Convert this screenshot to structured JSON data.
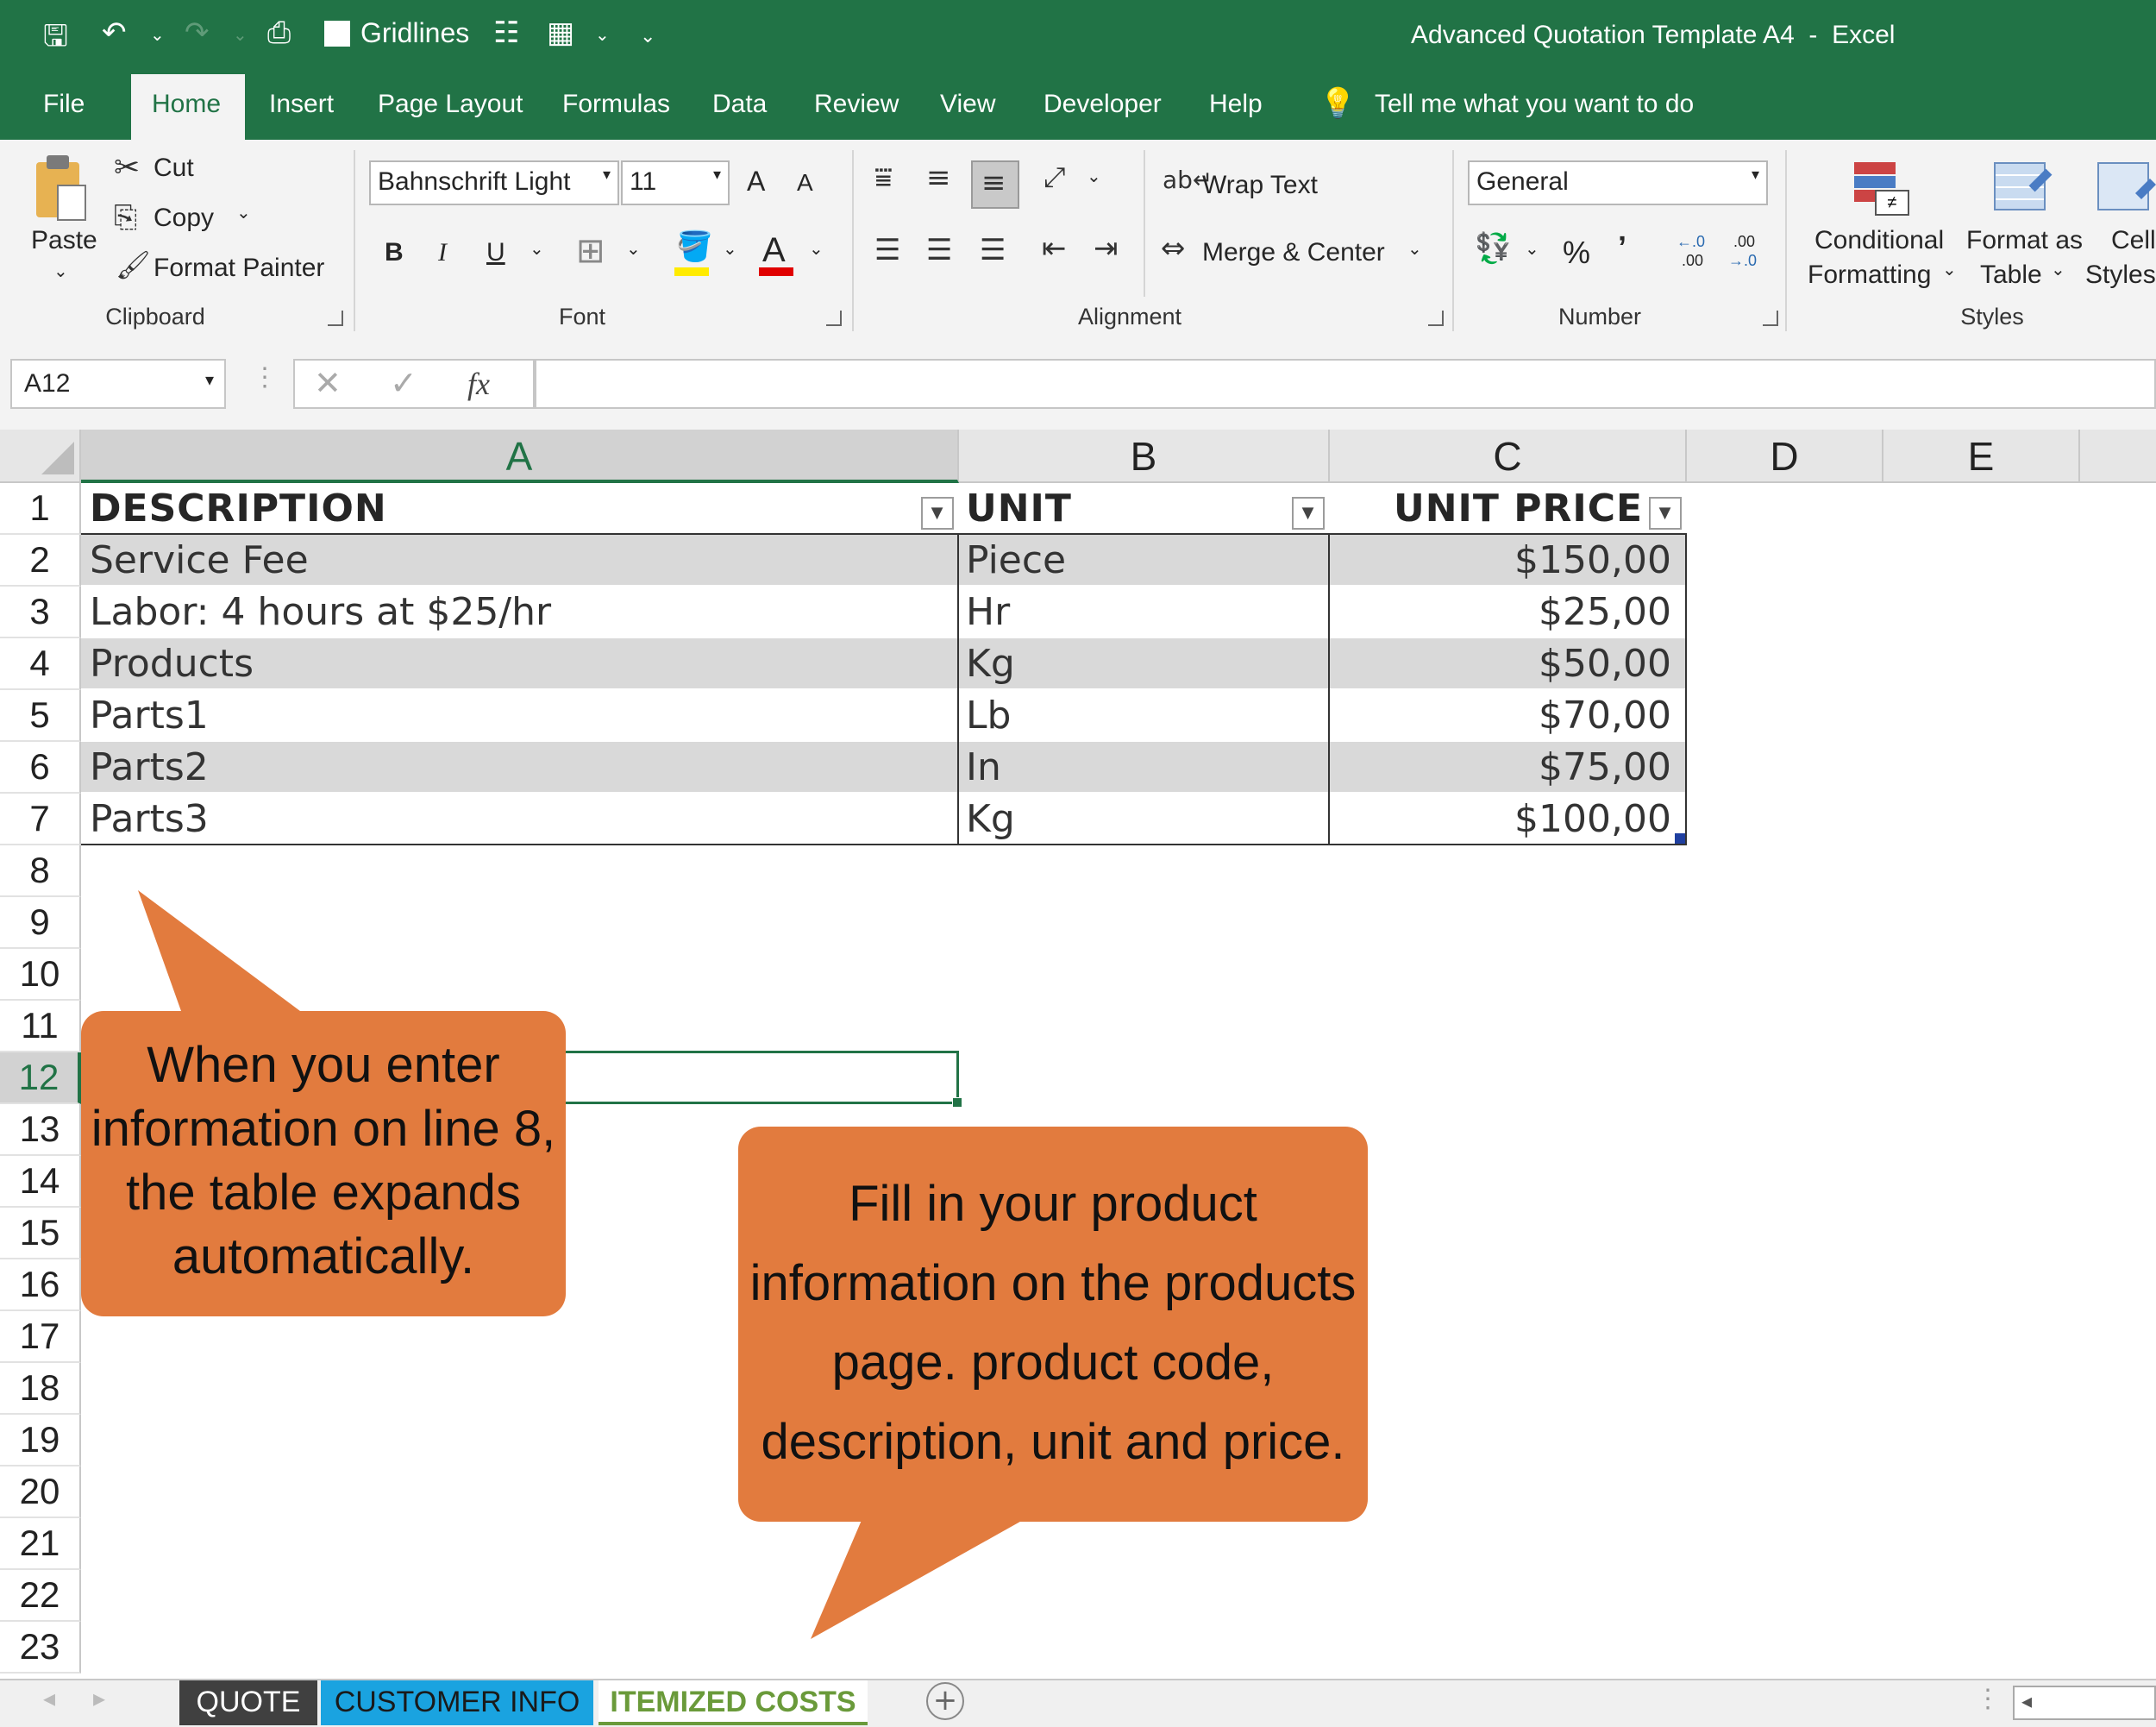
{
  "app": {
    "window_title": "Advanced Quotation Template A4  -  Excel",
    "gridlines_label": "Gridlines"
  },
  "ribbon_tabs": [
    "File",
    "Home",
    "Insert",
    "Page Layout",
    "Formulas",
    "Data",
    "Review",
    "View",
    "Developer",
    "Help"
  ],
  "tell_me": "Tell me what you want to do",
  "clipboard": {
    "paste": "Paste",
    "cut": "Cut",
    "copy": "Copy",
    "format_painter": "Format Painter",
    "group": "Clipboard"
  },
  "font": {
    "name": "Bahnschrift Light",
    "size": "11",
    "group": "Font",
    "bold": "B",
    "italic": "I",
    "underline": "U",
    "grow": "A",
    "shrink": "A",
    "color_letter": "A"
  },
  "alignment": {
    "wrap_text": "Wrap Text",
    "merge_center": "Merge & Center",
    "group": "Alignment"
  },
  "number": {
    "format": "General",
    "percent": "%",
    "comma": "ʼ",
    "inc_top": "←.0",
    "inc_bot": ".00",
    "dec_top": ".00",
    "dec_bot": "→.0",
    "group": "Number"
  },
  "styles": {
    "conditional_1": "Conditional",
    "conditional_2": "Formatting",
    "format_as_1": "Format as",
    "format_as_2": "Table",
    "cell_1": "Cell",
    "cell_2": "Styles",
    "group": "Styles"
  },
  "formula_bar": {
    "name_box": "A12",
    "fx": "fx",
    "value": ""
  },
  "columns": [
    "A",
    "B",
    "C",
    "D",
    "E"
  ],
  "rows": [
    "1",
    "2",
    "3",
    "4",
    "5",
    "6",
    "7",
    "8",
    "9",
    "10",
    "11",
    "12",
    "13",
    "14",
    "15",
    "16",
    "17",
    "18",
    "19",
    "20",
    "21",
    "22",
    "23"
  ],
  "table": {
    "headers": [
      "DESCRIPTION",
      "UNIT",
      "UNIT PRICE"
    ],
    "rows": [
      {
        "description": "Service Fee",
        "unit": "Piece",
        "price": "$150,00"
      },
      {
        "description": "Labor: 4 hours at $25/hr",
        "unit": "Hr",
        "price": "$25,00"
      },
      {
        "description": "Products",
        "unit": "Kg",
        "price": "$50,00"
      },
      {
        "description": "Parts1",
        "unit": "Lb",
        "price": "$70,00"
      },
      {
        "description": "Parts2",
        "unit": "In",
        "price": "$75,00"
      },
      {
        "description": "Parts3",
        "unit": "Kg",
        "price": "$100,00"
      }
    ]
  },
  "callouts": {
    "left": [
      "When you enter",
      "information on line 8,",
      "the table expands",
      "automatically."
    ],
    "right": [
      "Fill in your product",
      "information on the products",
      "page. product code,",
      "description, unit and price."
    ]
  },
  "sheets": [
    {
      "name": "QUOTE",
      "bg": "#404040",
      "fg": "#ffffff"
    },
    {
      "name": "CUSTOMER INFO",
      "bg": "#1aa3e0",
      "fg": "#1a1a1a"
    },
    {
      "name": "ITEMIZED COSTS",
      "bg": "#ffffff",
      "fg": "#6a9a3a"
    }
  ],
  "colors": {
    "excel_green": "#217346",
    "callout_orange": "#e27b3e",
    "band_gray": "#d9d9d9"
  }
}
